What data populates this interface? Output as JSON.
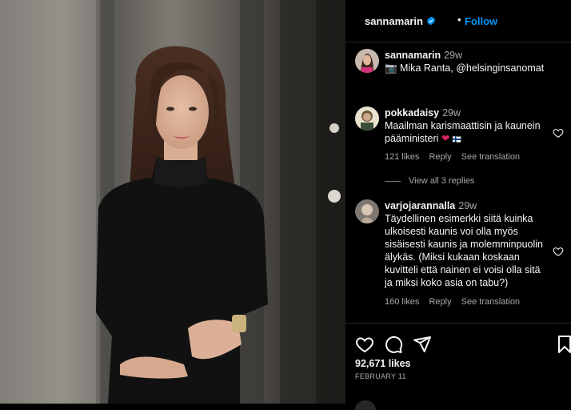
{
  "post": {
    "author": "sannamarin",
    "follow_label": "Follow",
    "dot": "•",
    "caption": {
      "author": "sannamarin",
      "time": "29w",
      "text": "📷 Mika Ranta, @helsinginsanomat"
    }
  },
  "comments": [
    {
      "username": "pokkadaisy",
      "time": "29w",
      "text": "Maailman karismaattisin ja kaunein pääministeri",
      "suffix": "🇫🇮",
      "likes": "121 likes",
      "reply": "Reply",
      "translate": "See translation"
    },
    {
      "username": "varjojarannalla",
      "time": "29w",
      "text": "Täydellinen esimerkki siitä kuinka ulkoisesti kaunis voi olla myös sisäisesti kaunis ja molemminpuolin älykäs. (Miksi kukaan koskaan kuvitteli että nainen ei voisi olla sitä ja miksi koko asia on tabu?)",
      "likes": "160 likes",
      "reply": "Reply",
      "translate": "See translation"
    }
  ],
  "view_replies": "View all 3 replies",
  "footer": {
    "likes": "92,671 likes",
    "date": "FEBRUARY 11"
  },
  "icons": {
    "like": "heart-icon",
    "comment": "comment-icon",
    "share": "share-icon",
    "save": "bookmark-icon",
    "verified": "verified-badge-icon",
    "camera": "camera-emoji-icon"
  },
  "colors": {
    "background": "#000000",
    "link": "#0095f6",
    "secondary_text": "#a8a8a8",
    "divider": "#262626",
    "heart_emoji": "#e0245e"
  }
}
